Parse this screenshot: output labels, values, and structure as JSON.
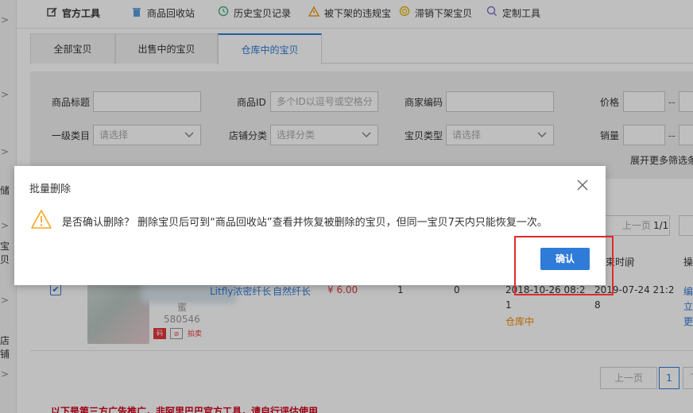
{
  "colors": {
    "accent": "#2f7bd8",
    "price": "#e4393c",
    "status": "#f08a00",
    "highlight": "#e02b2b",
    "notice": "#d0021b"
  },
  "sidebar": {
    "chevron": ">",
    "fragments": [
      "储",
      "宝贝",
      "店铺"
    ]
  },
  "toolbar": {
    "items": [
      {
        "icon": "edit-icon",
        "label": "官方工具"
      },
      {
        "icon": "trash-icon",
        "label": "商品回收站"
      },
      {
        "icon": "history-icon",
        "label": "历史宝贝记录"
      },
      {
        "icon": "warning-icon",
        "label": "被下架的违规宝"
      },
      {
        "icon": "target-icon",
        "label": "滞销下架宝贝"
      },
      {
        "icon": "search-icon",
        "label": "定制工具"
      }
    ]
  },
  "tabs": [
    {
      "label": "全部宝贝",
      "active": false
    },
    {
      "label": "出售中的宝贝",
      "active": false
    },
    {
      "label": "仓库中的宝贝",
      "active": true
    }
  ],
  "filters": {
    "title_label": "商品标题",
    "title_value": "",
    "id_label": "商品ID",
    "id_placeholder": "多个ID以逗号或空格分",
    "code_label": "商家编码",
    "code_value": "",
    "price_label": "价格",
    "price_sep": "--",
    "category_label": "一级类目",
    "category_placeholder": "请选择",
    "shop_cat_label": "店铺分类",
    "shop_cat_placeholder": "选择分类",
    "type_label": "宝贝类型",
    "type_placeholder": "请选择",
    "sales_label": "销量",
    "sales_sep": "--",
    "more": "展开更多筛选条"
  },
  "pager_top": {
    "prev": "上一页",
    "page": "1/1"
  },
  "table": {
    "headers": {
      "time": "束时间",
      "ops": "操"
    }
  },
  "row": {
    "title": "Litfly浓密纤长",
    "title_suffix": "自然纤长",
    "sub1": "蜜",
    "sub2": "580546",
    "badge": "码",
    "tag": "拍卖",
    "price": "¥ 6.00",
    "qty": "1",
    "sold": "0",
    "created_line1": "2018-10-26 08:2",
    "created_line2": "1",
    "status": "仓库中",
    "ended_line1": "2019-07-24 21:2",
    "ended_line2": "8",
    "ops": [
      "编",
      "立",
      "更"
    ]
  },
  "pager_bottom": {
    "prev": "上一页",
    "page": "1",
    "next": "下一"
  },
  "ad_notice": "以下是第三方广告推广，非阿里巴巴官方工具，请自行评估使用",
  "dialog": {
    "title": "批量删除",
    "message": "是否确认删除？ 删除宝贝后可到“商品回收站”查看并恢复被删除的宝贝，但同一宝贝7天内只能恢复一次。",
    "confirm": "确认"
  }
}
